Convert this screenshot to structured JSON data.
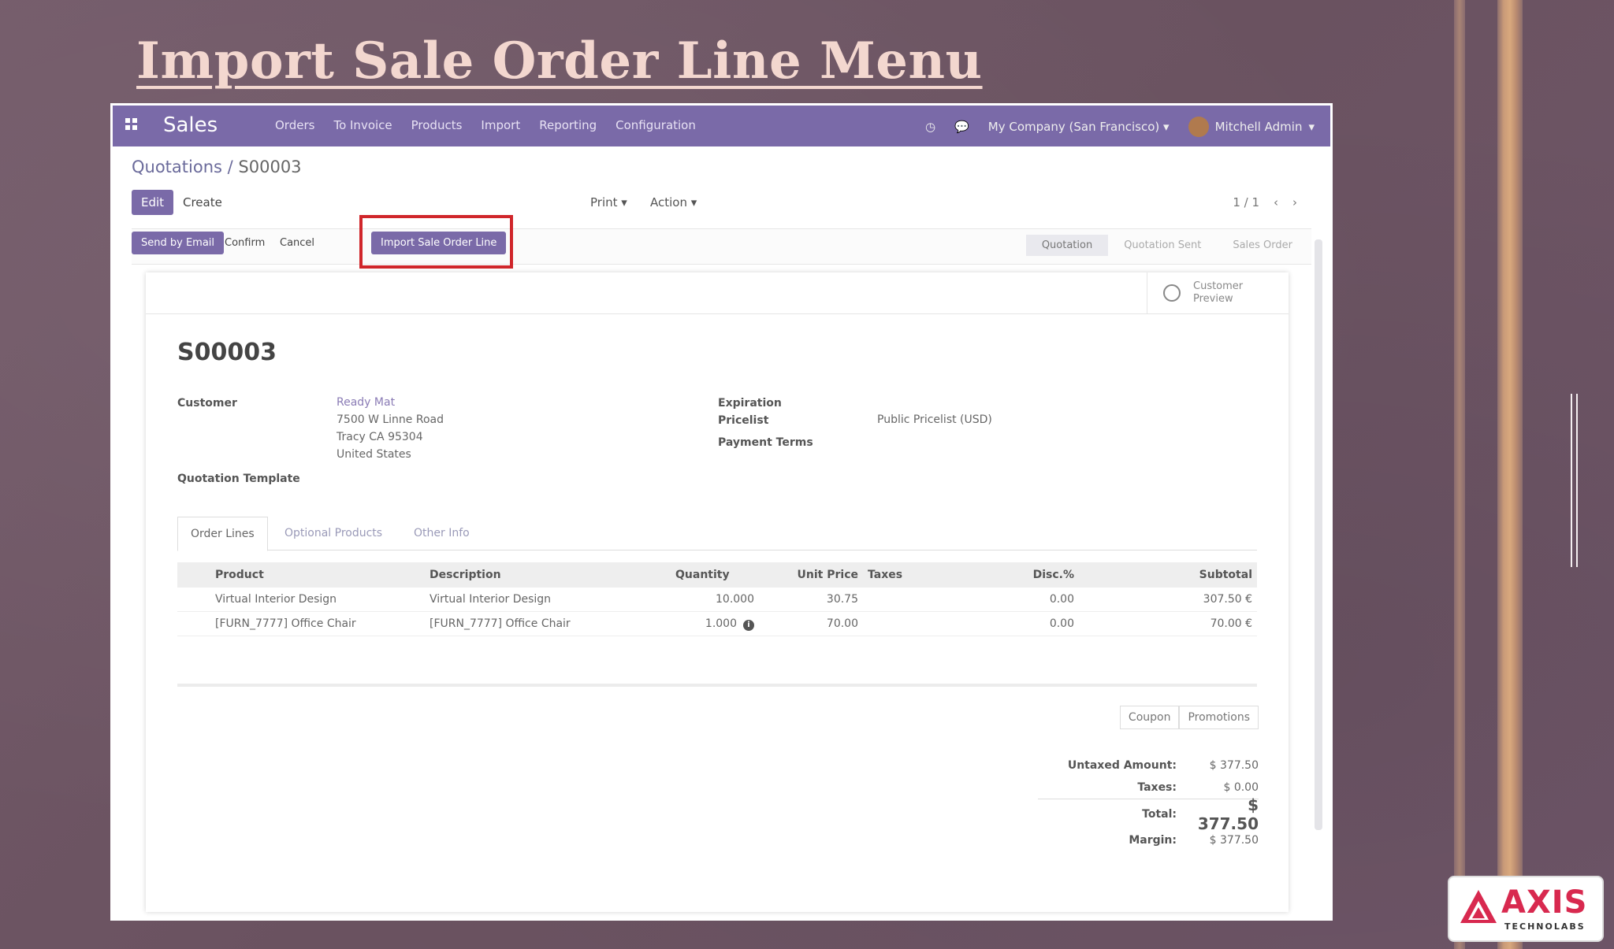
{
  "slide": {
    "title": "Import Sale Order Line Menu"
  },
  "navbar": {
    "app_name": "Sales",
    "menu": [
      "Orders",
      "To Invoice",
      "Products",
      "Import",
      "Reporting",
      "Configuration"
    ],
    "company": "My Company (San Francisco)",
    "user": "Mitchell Admin"
  },
  "breadcrumb": {
    "parent": "Quotations",
    "separator": " / ",
    "current": "S00003"
  },
  "toolbar": {
    "edit_label": "Edit",
    "create_label": "Create",
    "print_label": "Print",
    "action_label": "Action",
    "pager": "1 / 1"
  },
  "statusbar": {
    "send_email_label": "Send by Email",
    "confirm_label": "Confirm",
    "cancel_label": "Cancel",
    "import_label": "Import Sale Order Line",
    "stages": [
      "Quotation",
      "Quotation Sent",
      "Sales Order"
    ],
    "active_stage": "Quotation"
  },
  "portal": {
    "label": "Customer Preview"
  },
  "order": {
    "name": "S00003",
    "customer_label": "Customer",
    "customer_name": "Ready Mat",
    "address_line1": "7500 W Linne Road",
    "address_line2": "Tracy CA 95304",
    "address_line3": "United States",
    "quotation_template_label": "Quotation Template",
    "expiration_label": "Expiration",
    "pricelist_label": "Pricelist",
    "pricelist_value": "Public Pricelist (USD)",
    "payment_terms_label": "Payment Terms"
  },
  "tabs": [
    "Order Lines",
    "Optional Products",
    "Other Info"
  ],
  "order_lines": {
    "headers": [
      "Product",
      "Description",
      "Quantity",
      "Unit Price",
      "Taxes",
      "Disc.%",
      "Subtotal"
    ],
    "rows": [
      [
        "Virtual Interior Design",
        "Virtual Interior Design",
        "10.000",
        "30.75",
        "",
        "0.00",
        "307.50 €"
      ],
      [
        "[FURN_7777] Office Chair",
        "[FURN_7777] Office Chair",
        "1.000",
        "70.00",
        "",
        "0.00",
        "70.00 €"
      ]
    ]
  },
  "promo": {
    "coupon_label": "Coupon",
    "promotions_label": "Promotions"
  },
  "totals": {
    "untaxed_label": "Untaxed Amount:",
    "untaxed_value": "$ 377.50",
    "taxes_label": "Taxes:",
    "taxes_value": "$ 0.00",
    "total_label": "Total:",
    "total_value": "$ 377.50",
    "margin_label": "Margin:",
    "margin_value": "$ 377.50"
  },
  "brand": {
    "name": "AXIS",
    "tagline": "TECHNOLABS",
    "accent_color": "#d8294f"
  },
  "colors": {
    "navbar": "#7a6aa8",
    "highlight": "#d0262b",
    "slide_title": "#f3d7cf"
  }
}
